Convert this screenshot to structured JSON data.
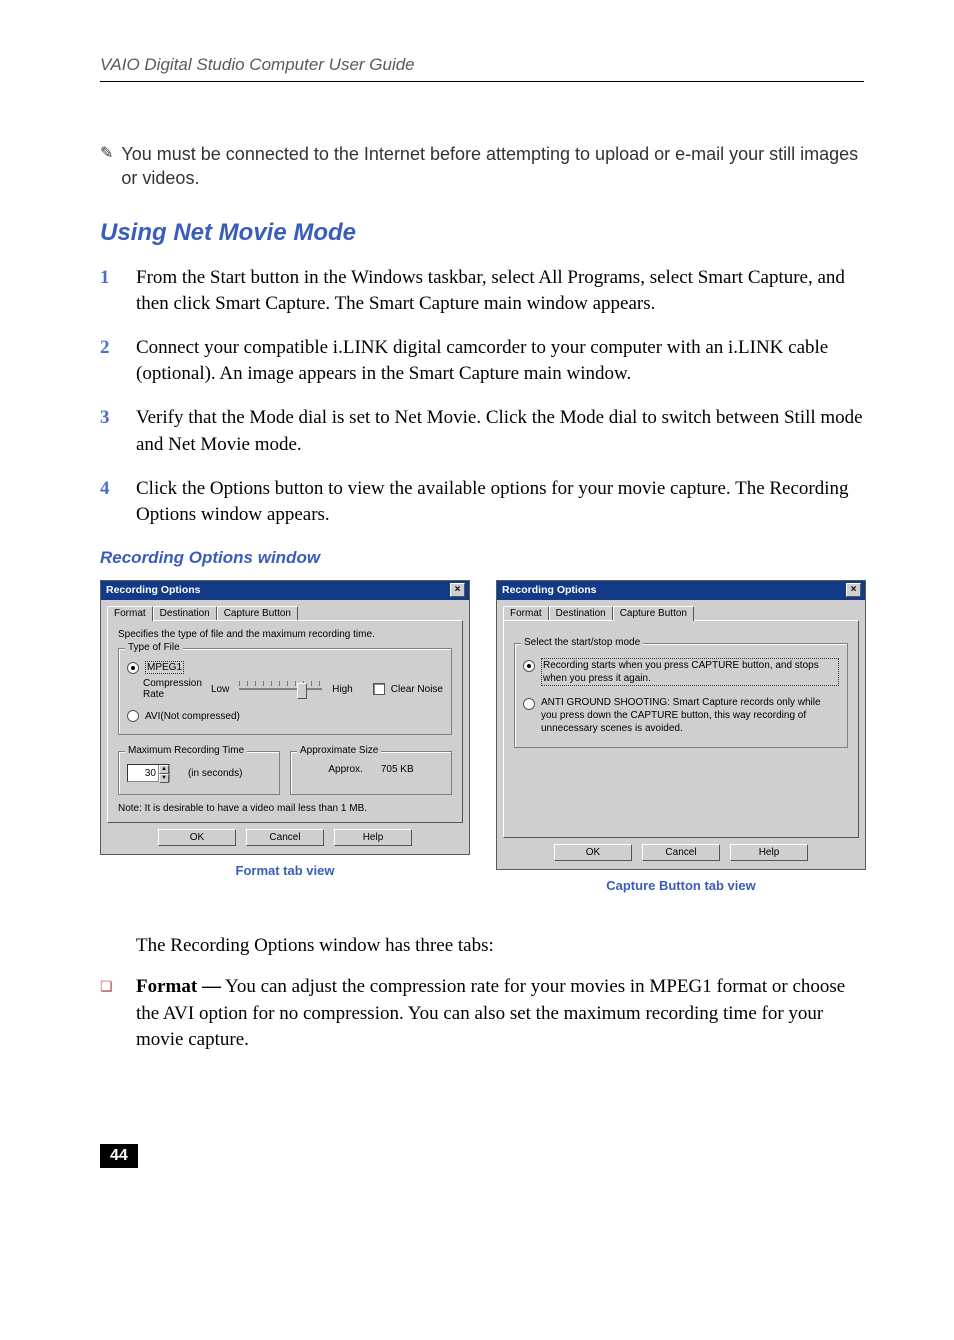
{
  "running_head": "VAIO Digital Studio Computer User Guide",
  "note": "You must be connected to the Internet before attempting to upload or e-mail your still images or videos.",
  "h2": "Using Net Movie Mode",
  "steps": [
    "From the Start button in the Windows taskbar, select All Programs, select Smart Capture, and then click Smart Capture. The Smart Capture main window appears.",
    "Connect your compatible i.LINK digital camcorder to your computer with an i.LINK cable (optional). An image appears in the Smart Capture main window.",
    "Verify that the Mode dial is set to Net Movie. Click the Mode dial to switch between Still mode and Net Movie mode.",
    "Click the Options button to view the available options for your movie capture. The Recording Options window appears."
  ],
  "caption": "Recording Options window",
  "dialog": {
    "title": "Recording Options",
    "tabs": {
      "format": "Format",
      "destination": "Destination",
      "capture": "Capture Button"
    },
    "buttons": {
      "ok": "OK",
      "cancel": "Cancel",
      "help": "Help"
    }
  },
  "format_tab": {
    "prompt": "Specifies the type of file and the maximum recording time.",
    "group_type": "Type of File",
    "mpeg": "MPEG1",
    "rate_label": "Compression Rate",
    "low": "Low",
    "high": "High",
    "clear": "Clear Noise",
    "avi": "AVI(Not compressed)",
    "group_max": "Maximum Recording Time",
    "max_val": "30",
    "sec": "(in seconds)",
    "group_size": "Approximate Size",
    "approx": "Approx.",
    "size_val": "705 KB",
    "note": "Note: It is desirable to have a video mail less than 1 MB."
  },
  "capture_tab": {
    "group": "Select the start/stop mode",
    "opt1": "Recording starts when you press CAPTURE button, and stops when you press it again.",
    "opt2": "ANTI GROUND SHOOTING: Smart Capture records only while you press down the CAPTURE button, this way recording of unnecessary scenes is avoided."
  },
  "subcaptions": {
    "left": "Format tab view",
    "right": "Capture Button tab view"
  },
  "para": "The Recording Options window has three tabs:",
  "bullet_label": "Format —",
  "bullet_body": " You can adjust the compression rate for your movies in MPEG1 format or choose the AVI option for no compression. You can also set the maximum recording time for your movie capture.",
  "page_number": "44"
}
